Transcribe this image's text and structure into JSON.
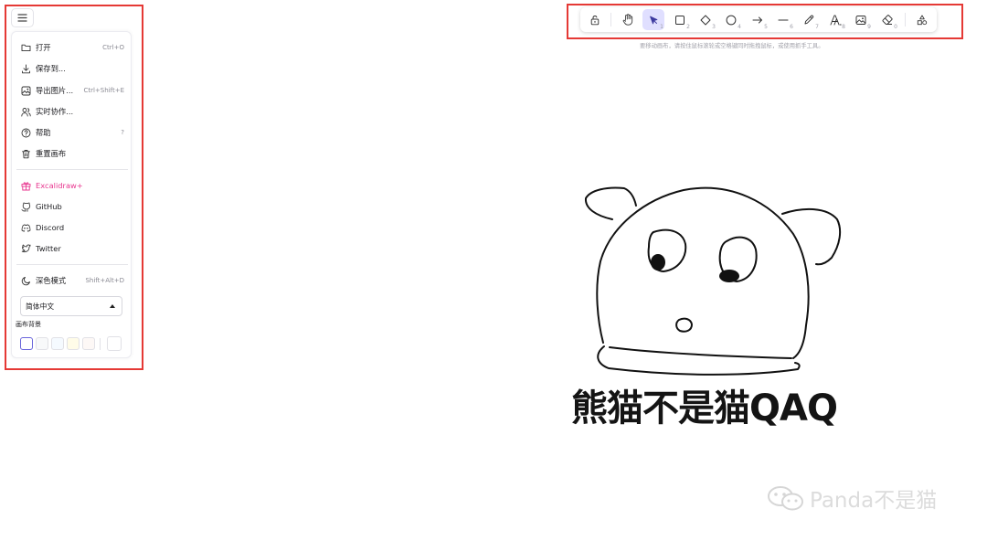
{
  "menu": {
    "items": [
      {
        "label": "打开",
        "shortcut": "Ctrl+O",
        "icon": "folder-icon"
      },
      {
        "label": "保存到...",
        "shortcut": "",
        "icon": "download-icon"
      },
      {
        "label": "导出图片...",
        "shortcut": "Ctrl+Shift+E",
        "icon": "image-export-icon"
      },
      {
        "label": "实时协作...",
        "shortcut": "",
        "icon": "users-icon"
      },
      {
        "label": "帮助",
        "shortcut": "?",
        "icon": "help-icon"
      },
      {
        "label": "重置画布",
        "shortcut": "",
        "icon": "trash-icon"
      }
    ],
    "links": [
      {
        "label": "Excalidraw+",
        "icon": "gift-icon"
      },
      {
        "label": "GitHub",
        "icon": "github-icon"
      },
      {
        "label": "Discord",
        "icon": "discord-icon"
      },
      {
        "label": "Twitter",
        "icon": "twitter-icon"
      }
    ],
    "dark_mode": {
      "label": "深色模式",
      "shortcut": "Shift+Alt+D"
    },
    "language": "简体中文",
    "canvas_bg_label": "画布背景",
    "bg_swatches": [
      "#ffffff",
      "#f8f9fa",
      "#f5faff",
      "#fffce8",
      "#fdf8f6"
    ],
    "custom_swatch": "#ffffff"
  },
  "toolbar": {
    "tools": [
      {
        "name": "lock",
        "num": ""
      },
      {
        "name": "hand",
        "num": ""
      },
      {
        "name": "selection",
        "num": "1"
      },
      {
        "name": "rectangle",
        "num": "2"
      },
      {
        "name": "diamond",
        "num": "3"
      },
      {
        "name": "ellipse",
        "num": "4"
      },
      {
        "name": "arrow",
        "num": "5"
      },
      {
        "name": "line",
        "num": "6"
      },
      {
        "name": "draw",
        "num": "7"
      },
      {
        "name": "text",
        "num": "8"
      },
      {
        "name": "image",
        "num": "9"
      },
      {
        "name": "eraser",
        "num": "0"
      },
      {
        "name": "library",
        "num": ""
      }
    ],
    "active_tool": "selection",
    "hint": "要移动画布，请按住鼠标滚轮或空格键同时拖拽鼠标，或使用抓手工具。"
  },
  "canvas": {
    "caption": "熊猫不是猫QAQ"
  },
  "watermark": {
    "text": "Panda不是猫"
  },
  "colors": {
    "accent": "#6965db",
    "active_tool_bg": "#e0dfff",
    "link_accent": "#e8368f",
    "annotation_red": "#e53935"
  }
}
